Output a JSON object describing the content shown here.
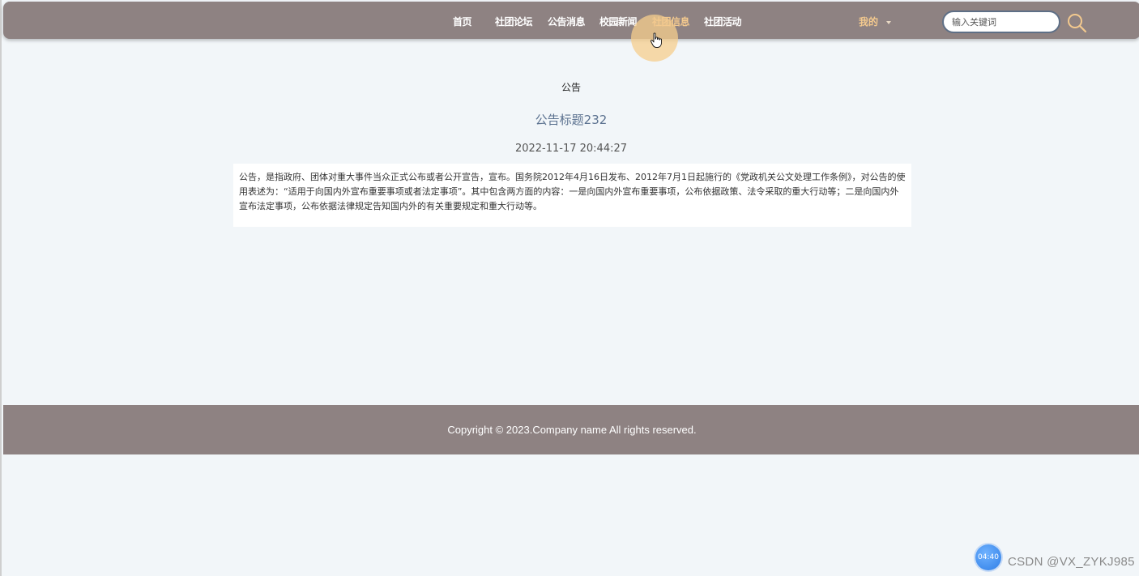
{
  "nav": {
    "items": [
      {
        "label": "首页"
      },
      {
        "label": "社团论坛"
      },
      {
        "label": "公告消息"
      },
      {
        "label": "校园新闻"
      },
      {
        "label": "社团信息"
      },
      {
        "label": "社团活动"
      }
    ],
    "active_index": 4,
    "mine_label": "我的",
    "search_placeholder": "输入关键词"
  },
  "main": {
    "section_label": "公告",
    "title": "公告标题232",
    "date": "2022-11-17 20:44:27",
    "content": "公告，是指政府、团体对重大事件当众正式公布或者公开宣告，宣布。国务院2012年4月16日发布、2012年7月1日起施行的《党政机关公文处理工作条例》，对公告的使用表述为：“适用于向国内外宣布重要事项或者法定事项”。其中包含两方面的内容：一是向国内外宣布重要事项，公布依据政策、法令采取的重大行动等；二是向国内外宣布法定事项，公布依据法律规定告知国内外的有关重要规定和重大行动等。"
  },
  "footer": {
    "copyright": "Copyright © 2023.Company name All rights reserved."
  },
  "overlay": {
    "timer": "04:40",
    "watermark": "CSDN @VX_ZYKJ985"
  },
  "colors": {
    "header_bg": "#8e8282",
    "active_nav": "#f3c98e",
    "title_color": "#5c7290",
    "page_bg": "#f2f6f9"
  },
  "icons": {
    "search": "search-icon",
    "cursor": "hand-cursor-icon",
    "dropdown": "chevron-down-icon"
  }
}
